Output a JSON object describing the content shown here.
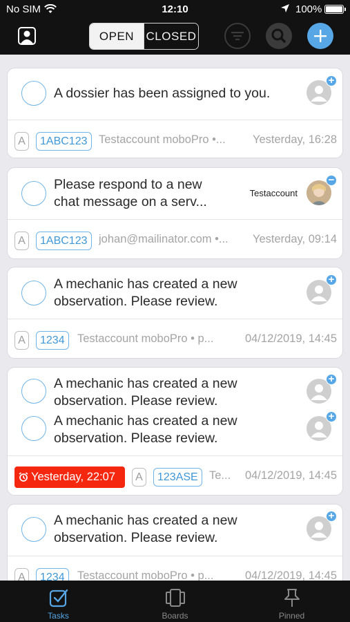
{
  "status_bar": {
    "carrier": "No SIM",
    "time": "12:10",
    "battery": "100%"
  },
  "header": {
    "segments": [
      {
        "label": "OPEN",
        "active": true
      },
      {
        "label": "CLOSED",
        "active": false
      }
    ],
    "icons": {
      "profile": "profile-icon",
      "filter": "filter-icon",
      "search": "search-icon",
      "add": "plus-icon"
    }
  },
  "colors": {
    "accent": "#57a7e6",
    "due_overdue": "#f5270f",
    "header_bg": "#121212"
  },
  "tasks": [
    {
      "title_lines": [
        "A dossier has been assigned to you."
      ],
      "tag": "A",
      "id": "1ABC123",
      "meta": "Testaccount moboPro •...",
      "date": "Yesterday, 16:28"
    },
    {
      "title_lines": [
        "Please respond to a new",
        "chat message on a serv..."
      ],
      "assignee": "Testaccount",
      "tag": "A",
      "id": "1ABC123",
      "meta": "johan@mailinator.com •...",
      "date": "Yesterday, 09:14"
    },
    {
      "title_lines": [
        "A mechanic has created a new",
        "observation. Please review."
      ],
      "tag": "A",
      "id": "1234",
      "meta": "Testaccount moboPro • p...",
      "date": "04/12/2019, 14:45"
    },
    {
      "title_lines": [
        "A mechanic has created a new",
        "observation. Please review."
      ],
      "subtask_lines": [
        "A mechanic has created a new",
        "observation. Please review."
      ],
      "due": "Yesterday, 22:07",
      "tag": "A",
      "id": "123ASE",
      "meta": "Te...",
      "date": "04/12/2019, 14:45"
    },
    {
      "title_lines": [
        "A mechanic has created a new",
        "observation. Please review."
      ],
      "tag": "A",
      "id": "1234",
      "meta": "Testaccount moboPro • p...",
      "date": "04/12/2019, 14:45"
    }
  ],
  "tabbar": [
    {
      "label": "Tasks",
      "icon": "tasks-checkbox-icon",
      "active": true
    },
    {
      "label": "Boards",
      "icon": "boards-icon",
      "active": false
    },
    {
      "label": "Pinned",
      "icon": "pin-icon",
      "active": false
    }
  ]
}
